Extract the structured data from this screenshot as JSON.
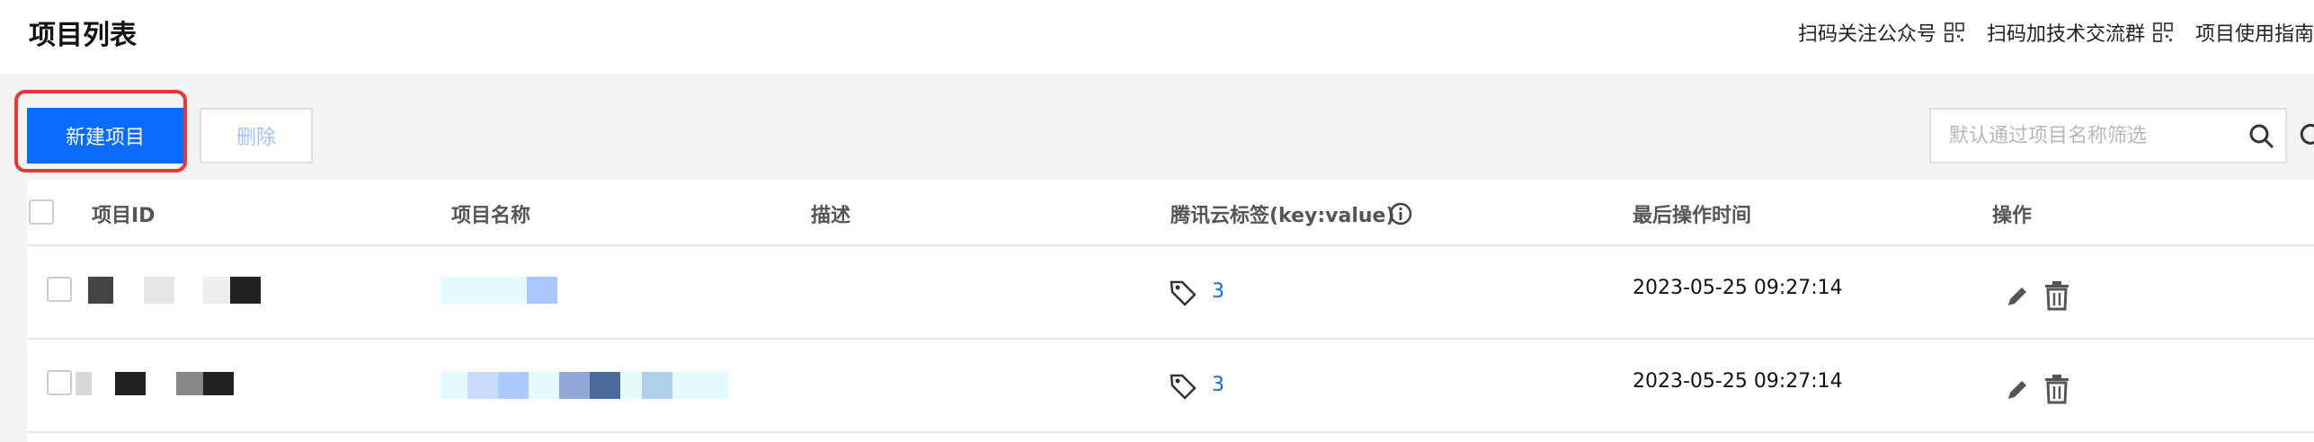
{
  "header": {
    "title": "项目列表",
    "links": [
      {
        "label": "扫码关注公众号",
        "icon": "qr-code-icon"
      },
      {
        "label": "扫码加技术交流群",
        "icon": "qr-code-icon"
      },
      {
        "label": "项目使用指南"
      }
    ]
  },
  "toolbar": {
    "new_label": "新建项目",
    "delete_label": "删除",
    "search_placeholder": "默认通过项目名称筛选"
  },
  "table": {
    "columns": [
      "项目ID",
      "项目名称",
      "描述",
      "腾讯云标签(key:value)",
      "最后操作时间",
      "操作"
    ],
    "rows": [
      {
        "tag_count": "3",
        "updated": "2023-05-25 09:27:14"
      },
      {
        "tag_count": "3",
        "updated": "2023-05-25 09:27:14"
      }
    ]
  },
  "colors": {
    "primary": "#0a6cff",
    "highlight": "#e53935",
    "background": "#f2f3f5"
  }
}
